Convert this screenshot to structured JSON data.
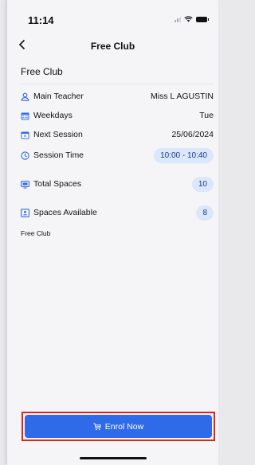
{
  "status_bar": {
    "time": "11:14"
  },
  "nav": {
    "title": "Free Club",
    "back_icon": "chevron-left-icon"
  },
  "club": {
    "title": "Free Club"
  },
  "details": [
    {
      "key": "main-teacher",
      "icon": "user-icon",
      "label": "Main Teacher",
      "value": "Miss L AGUSTIN",
      "pill": false
    },
    {
      "key": "weekdays",
      "icon": "calendar-grid-icon",
      "label": "Weekdays",
      "value": "Tue",
      "pill": false
    },
    {
      "key": "next-session",
      "icon": "calendar-day-icon",
      "label": "Next Session",
      "value": "25/06/2024",
      "pill": false
    },
    {
      "key": "session-time",
      "icon": "clock-icon",
      "label": "Session Time",
      "value": "10:00 - 10:40",
      "pill": true
    },
    {
      "key": "total-spaces",
      "icon": "monitor-icon",
      "label": "Total Spaces",
      "value": "10",
      "pill": true
    },
    {
      "key": "spaces-available",
      "icon": "id-card-icon",
      "label": "Spaces Available",
      "value": "8",
      "pill": true
    }
  ],
  "description": "Free Club",
  "enrol": {
    "label": "Enrol Now",
    "icon": "cart-icon"
  },
  "colors": {
    "accent": "#2f6ae8",
    "pill_bg": "#dbe7fb",
    "highlight": "#e2231a"
  }
}
